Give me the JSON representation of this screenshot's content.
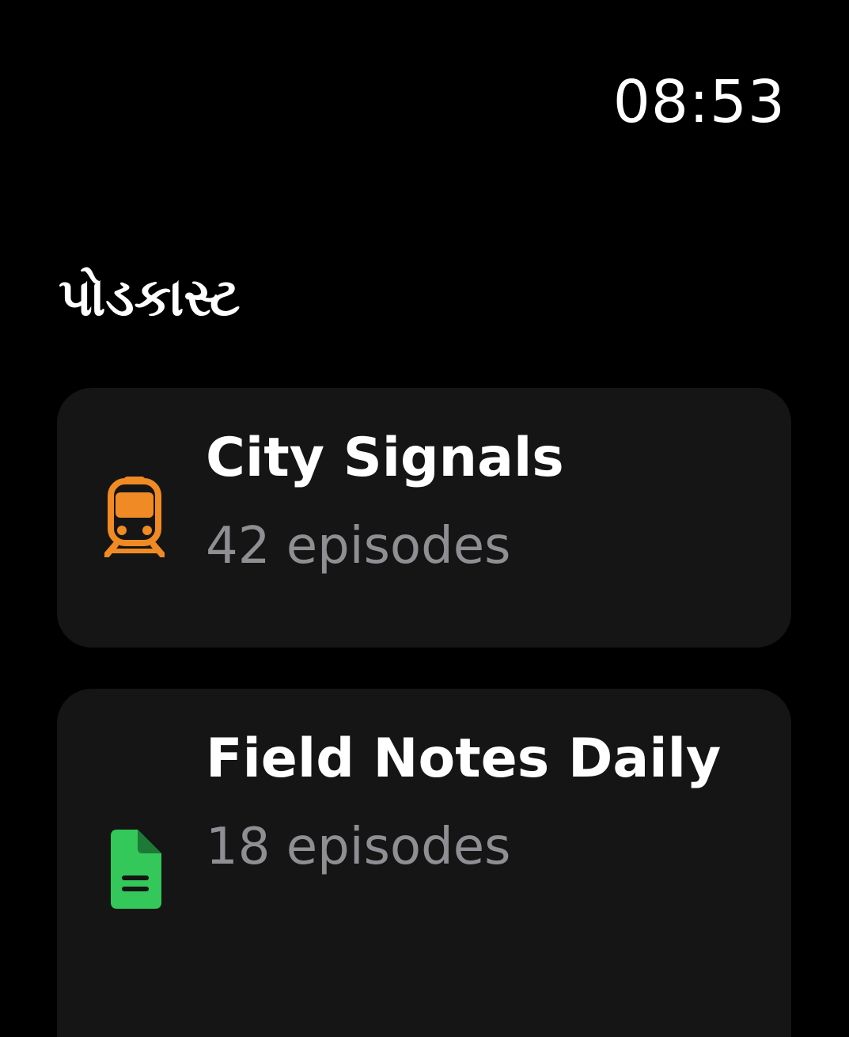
{
  "status": {
    "time": "08:53"
  },
  "header": {
    "title": "પોડકાસ્ટ"
  },
  "podcasts": [
    {
      "title": "City Signals",
      "subtitle": "42 episodes",
      "icon": "train-icon",
      "icon_color": "#F08A24"
    },
    {
      "title": "Field Notes Daily",
      "subtitle": "18 episodes",
      "icon": "document-icon",
      "icon_color": "#34C759"
    }
  ],
  "colors": {
    "background": "#000000",
    "card": "#151515",
    "text_primary": "#FFFFFF",
    "text_secondary": "#8E8E93"
  }
}
